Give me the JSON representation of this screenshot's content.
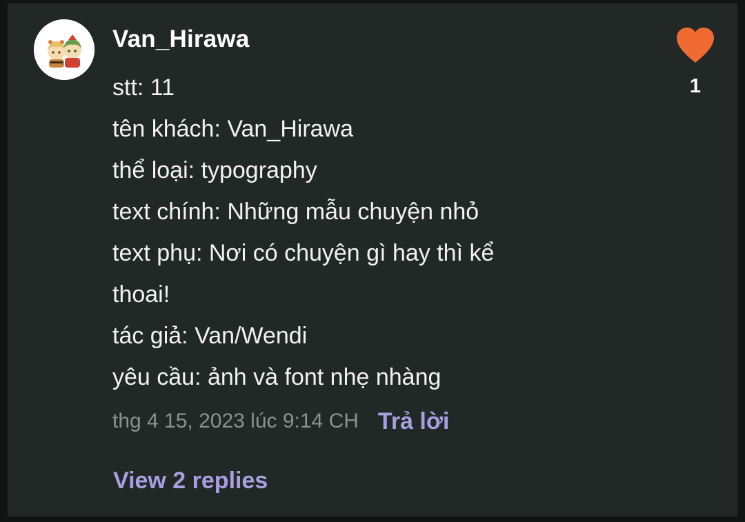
{
  "comment": {
    "username": "Van_Hirawa",
    "lines": [
      "stt: 11",
      "tên khách: Van_Hirawa",
      "thể loại: typography",
      "text chính: Những mẫu chuyện nhỏ",
      "text phụ: Nơi có chuyện gì hay thì kể",
      "thoai!",
      "tác giả: Van/Wendi",
      "yêu cầu: ảnh và font nhẹ nhàng"
    ],
    "timestamp": "thg 4 15, 2023 lúc 9:14 CH",
    "reply_label": "Trả lời",
    "view_replies_label": "View 2 replies",
    "like_count": "1",
    "like_icon": "heart-icon",
    "avatar_icon": "avatar"
  },
  "colors": {
    "background": "#212826",
    "text": "#f2f2f2",
    "muted": "#8b918f",
    "accent": "#a99ee0",
    "heart": "#f06b32"
  }
}
